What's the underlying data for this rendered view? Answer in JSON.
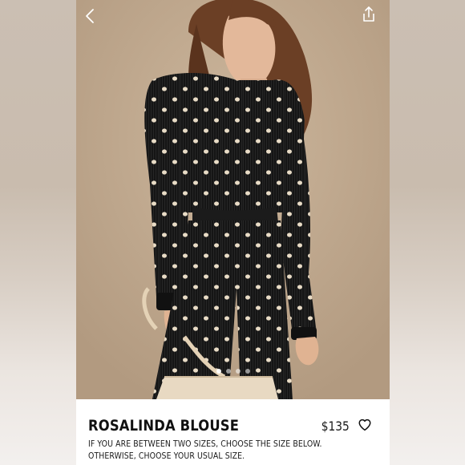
{
  "product": {
    "title": "ROSALINDA BLOUSE",
    "price": "$135",
    "note": "IF YOU ARE BETWEEN TWO SIZES, CHOOSE THE SIZE BELOW. OTHERWISE, CHOOSE YOUR USUAL SIZE."
  },
  "icons": {
    "back": "chevron-left-icon",
    "share": "share-icon",
    "favorite": "heart-outline-icon"
  },
  "gallery": {
    "total_images": 4,
    "active_index": 1
  },
  "colors": {
    "garment": "#141414",
    "polka_dot": "#e9dcc6",
    "background": "#c5ad93",
    "text": "#111111"
  }
}
